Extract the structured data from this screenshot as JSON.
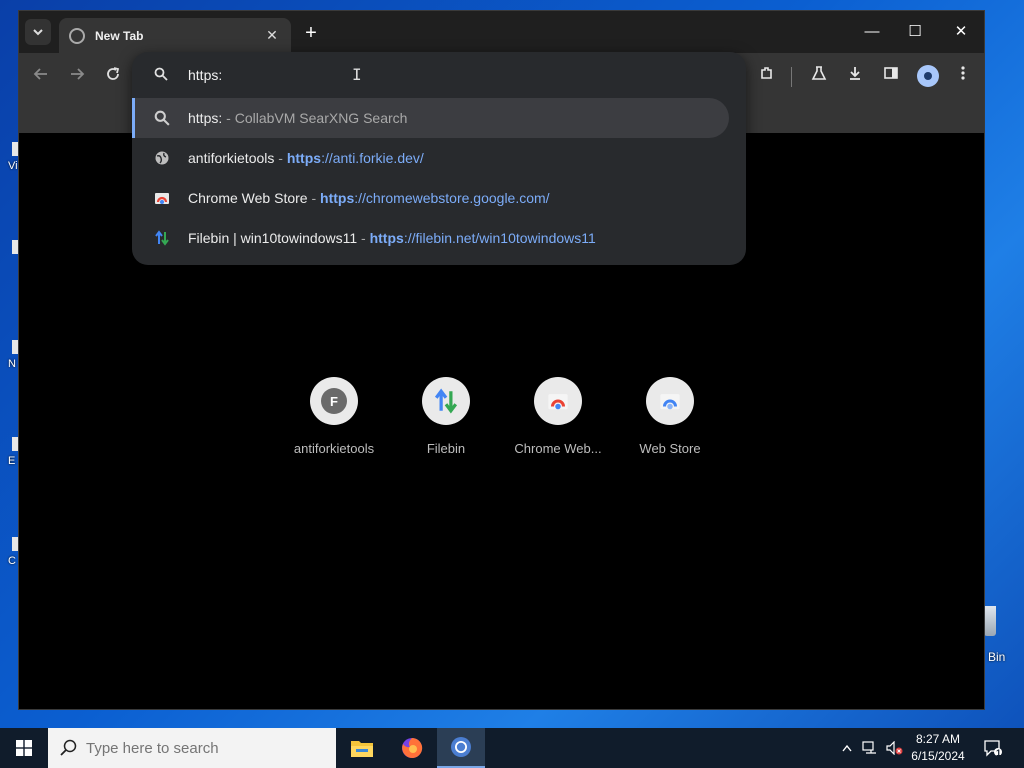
{
  "desktop": {
    "icons": [
      {
        "letter": "Vi"
      },
      {
        "letter": ""
      },
      {
        "letter": "N"
      },
      {
        "letter": "E"
      },
      {
        "letter": "C"
      }
    ],
    "recycle_bin_label": "Bin"
  },
  "browser": {
    "tab": {
      "title": "New Tab"
    },
    "new_tab_symbol": "+",
    "window_controls": {
      "minimize": "—",
      "maximize": "☐",
      "close": "✕"
    },
    "omnibox": {
      "value": "https:",
      "suggestions": [
        {
          "main": "https:",
          "separator": " - ",
          "secondary": "CollabVM SearXNG Search",
          "icon": "search-icon",
          "selected": true
        },
        {
          "main": "antiforkietools",
          "separator": " - ",
          "url_bold": "https",
          "url_rest": "://anti.forkie.dev/",
          "icon": "globe-icon"
        },
        {
          "main": "Chrome Web Store",
          "separator": " - ",
          "url_bold": "https",
          "url_rest": "://chromewebstore.google.com/",
          "icon": "webstore-icon"
        },
        {
          "main": "Filebin | win10towindows11",
          "separator": " - ",
          "url_bold": "https",
          "url_rest": "://filebin.net/win10towindows11",
          "icon": "filebin-icon"
        }
      ]
    },
    "shortcuts": [
      {
        "label": "antiforkietools",
        "letter": "F"
      },
      {
        "label": "Filebin"
      },
      {
        "label": "Chrome Web..."
      },
      {
        "label": "Web Store"
      }
    ]
  },
  "taskbar": {
    "search_placeholder": "Type here to search",
    "clock_time": "8:27 AM",
    "clock_date": "6/15/2024",
    "notification_count": "1"
  },
  "colors": {
    "accent": "#7cacf8",
    "omnibox_bg": "#282a2d",
    "toolbar_bg": "#353535"
  }
}
